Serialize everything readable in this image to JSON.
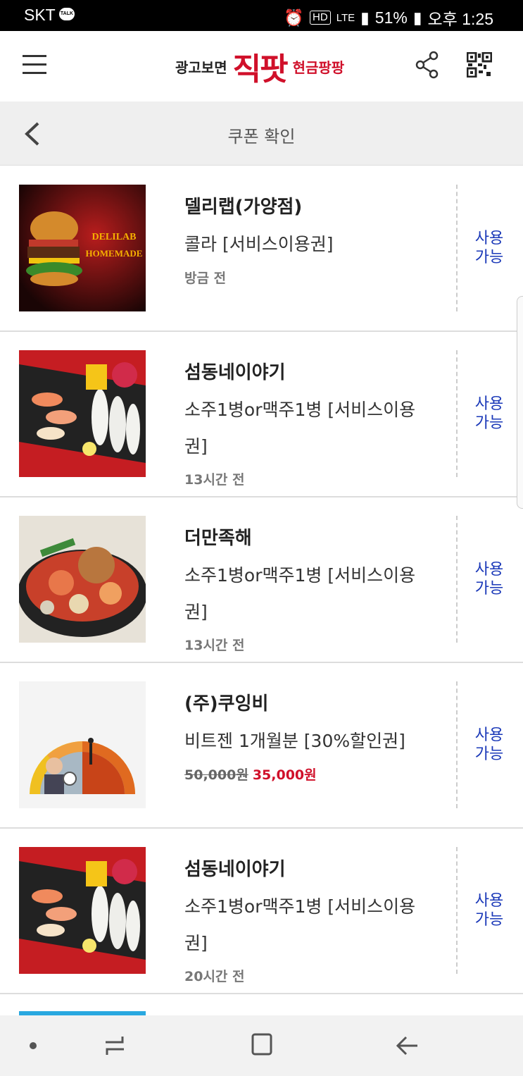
{
  "status_bar": {
    "carrier": "SKT",
    "talk_badge": "TALK",
    "hd_badge": "HD",
    "lte": "LTE",
    "battery": "51%",
    "time": "오후 1:25"
  },
  "app_bar": {
    "logo_pre": "광고보면",
    "logo_main": "직팟",
    "logo_post": "현금팡팡"
  },
  "sub_bar": {
    "title": "쿠폰 확인"
  },
  "coupons": [
    {
      "store": "델리랩(가양점)",
      "item": "콜라 [서비스이용권]",
      "time": "방금 전",
      "action": "사용\n가능",
      "image": "burger-image",
      "image_text": "DELILAB HOMEMADE"
    },
    {
      "store": "섬동네이야기",
      "item": "소주1병or맥주1병 [서비스이용권]",
      "time": "13시간 전",
      "action": "사용\n가능",
      "image": "sushi-platter-image"
    },
    {
      "store": "더만족해",
      "item": "소주1병or맥주1병 [서비스이용권]",
      "time": "13시간 전",
      "action": "사용\n가능",
      "image": "seafood-stew-image"
    },
    {
      "store": "(주)쿠잉비",
      "item": "비트젠 1개월분 [30%할인권]",
      "price_old": "50,000원",
      "price_new": "35,000원",
      "action": "사용\n가능",
      "image": "gauge-illustration-image"
    },
    {
      "store": "섬동네이야기",
      "item": "소주1병or맥주1병 [서비스이용권]",
      "time": "20시간 전",
      "action": "사용\n가능",
      "image": "sushi-platter-image"
    }
  ],
  "colors": {
    "accent_red": "#d0102a",
    "action_blue": "#1a38b8"
  }
}
